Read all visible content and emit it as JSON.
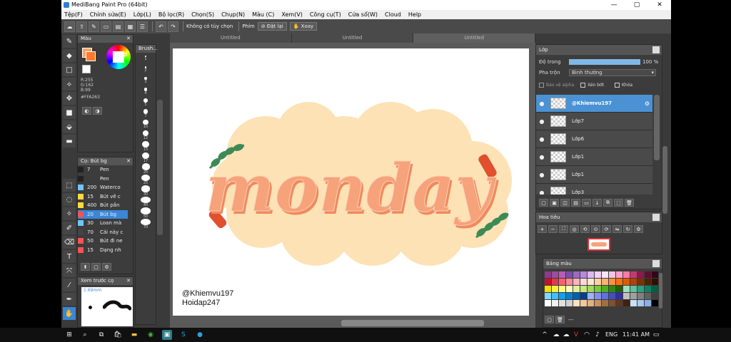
{
  "window": {
    "title": "MediBang Paint Pro (64bit)",
    "minimize": "—",
    "maximize": "▢",
    "close": "✕"
  },
  "menu": [
    "Tệp(F)",
    "Chỉnh sửa(E)",
    "Lớp(L)",
    "Bộ lọc(R)",
    "Chọn(S)",
    "Chụp(N)",
    "Màu (C)",
    "Xem(V)",
    "Công cụ(T)",
    "Cửa sổ(W)",
    "Cloud",
    "Help"
  ],
  "toolbar": {
    "mode_label": "Không có tùy chọn",
    "shortcut_label": "Phím",
    "reset_label": "Đặt lại",
    "rotate_label": "Xoay"
  },
  "color_panel": {
    "title": "Màu",
    "rgb_r": "R:255",
    "rgb_g": "G:162",
    "rgb_b": "B:99",
    "hex": "#FFA263",
    "primary": "#ffa263"
  },
  "brush_panel": {
    "title": "Cọ: Bút bg",
    "items": [
      {
        "size": "7",
        "name": "Pen",
        "color": "#222222"
      },
      {
        "size": "",
        "name": "Pen",
        "color": "#222222"
      },
      {
        "size": "200",
        "name": "Waterco",
        "color": "#6ec6ff"
      },
      {
        "size": "15",
        "name": "Bút vẽ c",
        "color": "#ffd740"
      },
      {
        "size": "400",
        "name": "Bút pần",
        "color": "#ffd740"
      },
      {
        "size": "20",
        "name": "Bút bg",
        "color": "#ff5252"
      },
      {
        "size": "30",
        "name": "Loan mà",
        "color": "#6ec6ff"
      },
      {
        "size": "70",
        "name": "Cái này c",
        "color": "#444444"
      },
      {
        "size": "50",
        "name": "Bút đi ne",
        "color": "#ff5252"
      },
      {
        "size": "15",
        "name": "Dạng nh",
        "color": "#ff5252"
      }
    ],
    "selected_index": 5
  },
  "preview_panel": {
    "title": "Xem trước cọ",
    "size": "1.69mm"
  },
  "brush_size_panel": {
    "title": "Brush...",
    "sizes": [
      "1",
      "2",
      "3",
      "4",
      "5",
      "7",
      "10",
      "12",
      "15",
      "17",
      "20",
      "25",
      "30",
      "40",
      "50",
      "70"
    ]
  },
  "tabs": [
    "Untitled",
    "Untitled",
    "Untitled"
  ],
  "canvas": {
    "word": "monday",
    "credit_line1": "@Khiemvu197",
    "credit_line2": "Hoidap247",
    "bg_blob": "#fde2b5",
    "letter_fill": "#f6a27a",
    "letter_shadow": "#f08a5d",
    "leaf": "#3d8a55",
    "accent": "#e0502e"
  },
  "layer_panel": {
    "title": "Lớp",
    "opacity_label": "Độ trong",
    "opacity_value": "100 %",
    "opacity": 1.0,
    "blend_label": "Pha trộn",
    "blend_value": "Bình thường",
    "protect_alpha": "Bảo vệ alpha",
    "clipping": "Xén bớt",
    "lock": "Khóa",
    "layers": [
      {
        "name": "@Khiemvu197",
        "selected": true
      },
      {
        "name": "Lớp7",
        "selected": false
      },
      {
        "name": "Lớp6",
        "selected": false
      },
      {
        "name": "Lớp1",
        "selected": false
      },
      {
        "name": "Lớp1",
        "selected": false
      },
      {
        "name": "Lớp3",
        "selected": false
      }
    ]
  },
  "navigator_panel": {
    "title": "Hoa tiêu"
  },
  "palette_panel": {
    "title": "Bảng màu",
    "footer": "---",
    "colors": [
      "#8a3b8a",
      "#a04aa0",
      "#b85cb8",
      "#7b4fa8",
      "#9a6ac0",
      "#b988d8",
      "#e0b8f0",
      "#f0d0f8",
      "#f7e4fb",
      "#f2c4e0",
      "#ffa0c8",
      "#ff7aa8",
      "#c83870",
      "#8a1a4a",
      "#5a1030",
      "#300818",
      "#c8102e",
      "#e03a4a",
      "#ff6070",
      "#ff8a95",
      "#ffb3ba",
      "#ffd8db",
      "#ffe8d0",
      "#ffd0a0",
      "#ffb070",
      "#ff9040",
      "#ff7010",
      "#e05a00",
      "#b04400",
      "#803000",
      "#502000",
      "#301000",
      "#f0e000",
      "#f8f040",
      "#ffff80",
      "#fffcc0",
      "#e0f0a0",
      "#c8e880",
      "#a0d860",
      "#78c840",
      "#50b020",
      "#308810",
      "#206008",
      "#a0e0c0",
      "#60c0a0",
      "#30a080",
      "#108060",
      "#006040",
      "#80d8ff",
      "#40c0ff",
      "#10a0f0",
      "#0080d0",
      "#0060b0",
      "#004090",
      "#a0b0ff",
      "#8090f0",
      "#6070e0",
      "#4050c0",
      "#3030a0",
      "#c0c0c0",
      "#a0a0a0",
      "#808080",
      "#606060",
      "#404040",
      "#ffffff",
      "#f0f0f0",
      "#e0e0e0",
      "#d0d0d0",
      "#ffe0c0",
      "#f0c8a0",
      "#e0b080",
      "#c89060",
      "#a07040",
      "#805030",
      "#603820",
      "#402010",
      "#c8e0f8",
      "#a8c8f0",
      "#88b0e8",
      "#000000"
    ]
  },
  "taskbar": {
    "lang": "ENG",
    "time": "11:41 AM"
  }
}
